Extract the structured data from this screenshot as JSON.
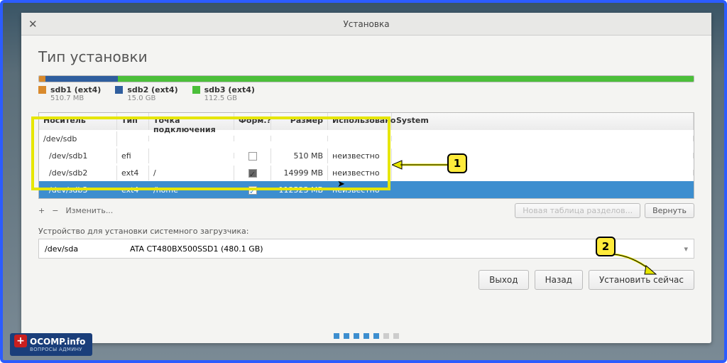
{
  "window": {
    "title": "Установка",
    "page_title": "Тип установки"
  },
  "legend": [
    {
      "label": "sdb1 (ext4)",
      "size": "510.7 MB",
      "color": "#d98a2d"
    },
    {
      "label": "sdb2 (ext4)",
      "size": "15.0 GB",
      "color": "#2f5e9e"
    },
    {
      "label": "sdb3 (ext4)",
      "size": "112.5 GB",
      "color": "#4bbf3a"
    }
  ],
  "columns": {
    "device": "Носитель",
    "type": "Тип",
    "mount": "Точка подключения",
    "format": "Форм.?",
    "size": "Размер",
    "used": "Использовано",
    "system": "System"
  },
  "rows": [
    {
      "device": "/dev/sdb",
      "type": "",
      "mount": "",
      "format": "",
      "size": "",
      "used": ""
    },
    {
      "device": "/dev/sdb1",
      "type": "efi",
      "mount": "",
      "format": "empty",
      "size": "510 MB",
      "used": "неизвестно"
    },
    {
      "device": "/dev/sdb2",
      "type": "ext4",
      "mount": "/",
      "format": "checked",
      "size": "14999 MB",
      "used": "неизвестно"
    },
    {
      "device": "/dev/sdb3",
      "type": "ext4",
      "mount": "/home",
      "format": "white",
      "size": "112523 MB",
      "used": "неизвестно",
      "selected": true
    }
  ],
  "toolbar": {
    "plus": "+",
    "minus": "−",
    "change": "Изменить...",
    "new_table": "Новая таблица разделов...",
    "revert": "Вернуть"
  },
  "loader": {
    "label": "Устройство для установки системного загрузчика:",
    "device": "/dev/sda",
    "desc": "ATA CT480BX500SSD1 (480.1 GB)"
  },
  "buttons": {
    "quit": "Выход",
    "back": "Назад",
    "install": "Установить сейчас"
  },
  "badges": {
    "b1": "1",
    "b2": "2"
  },
  "logo": {
    "main": "OCOMP.info",
    "sub": "ВОПРОСЫ АДМИНУ"
  }
}
